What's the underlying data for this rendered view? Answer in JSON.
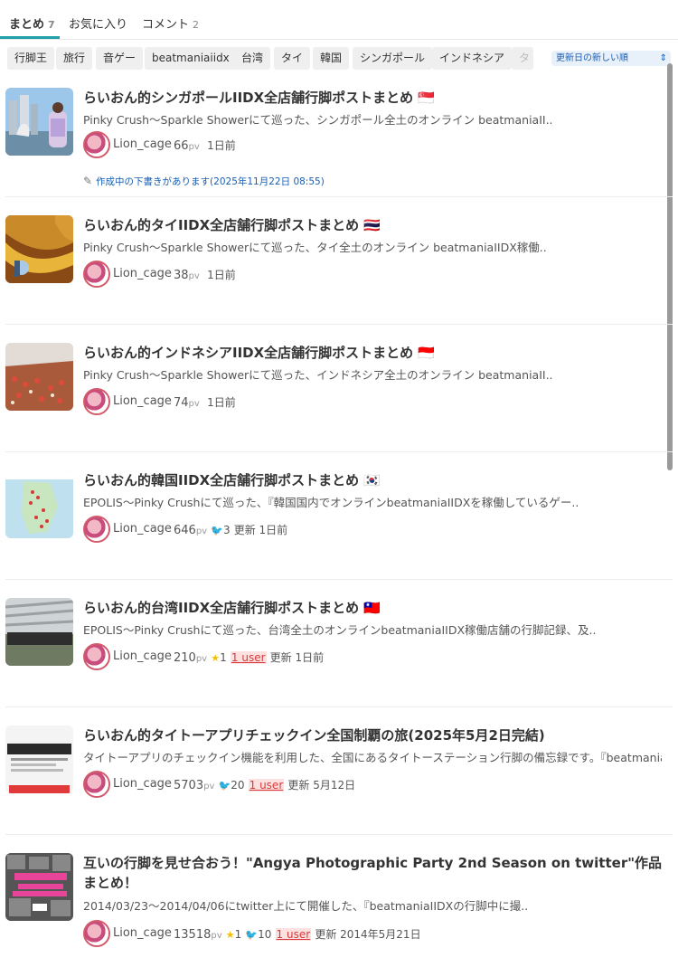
{
  "tabs": [
    {
      "label": "まとめ",
      "count": "7"
    },
    {
      "label": "お気に入り",
      "count": ""
    },
    {
      "label": "コメント",
      "count": "2"
    }
  ],
  "tags": [
    "行脚王",
    "旅行",
    "音ゲー",
    "beatmaniaiidx",
    "台湾",
    "タイ",
    "韓国",
    "シンガポール",
    "インドネシア",
    "タ"
  ],
  "sort": {
    "selected": "更新日の新しい順"
  },
  "draft_notice": "作成中の下書きがあります(2025年11月22日 08:55)",
  "items": [
    {
      "title": "らいおん的シンガポールIIDX全店舗行脚ポストまとめ",
      "flag": "🇸🇬",
      "desc": "Pinky Crush〜Sparkle Showerにて巡った、シンガポール全土のオンライン beatmaniaII..",
      "user": "Lion_cage",
      "pv": "66",
      "time": "1日前"
    },
    {
      "title": "らいおん的タイIIDX全店舗行脚ポストまとめ",
      "flag": "🇹🇭",
      "desc": "Pinky Crush〜Sparkle Showerにて巡った、タイ全土のオンライン beatmaniaIIDX稼働..",
      "user": "Lion_cage",
      "pv": "38",
      "time": "1日前"
    },
    {
      "title": "らいおん的インドネシアIIDX全店舗行脚ポストまとめ",
      "flag": "🇮🇩",
      "desc": "Pinky Crush〜Sparkle Showerにて巡った、インドネシア全土のオンライン beatmaniaII..",
      "user": "Lion_cage",
      "pv": "74",
      "time": "1日前"
    },
    {
      "title": "らいおん的韓国IIDX全店舗行脚ポストまとめ",
      "flag": "🇰🇷",
      "desc": "EPOLIS〜Pinky Crushにて巡った、『韓国国内でオンラインbeatmaniaIIDXを稼働しているゲー..",
      "user": "Lion_cage",
      "pv": "646",
      "tweets": "3",
      "time": "更新 1日前"
    },
    {
      "title": "らいおん的台湾IIDX全店舗行脚ポストまとめ",
      "flag": "🇹🇼",
      "desc": "EPOLIS〜Pinky Crushにて巡った、台湾全土のオンラインbeatmaniaIIDX稼働店舗の行脚記録、及..",
      "user": "Lion_cage",
      "pv": "210",
      "stars": "1",
      "users": "1 user",
      "time": "更新 1日前"
    },
    {
      "title": "らいおん的タイトーアプリチェックイン全国制覇の旅(2025年5月2日完結)",
      "flag": "",
      "desc": "タイトーアプリのチェックイン機能を利用した、全国にあるタイトーステーション行脚の備忘録です。『beatmanial..",
      "user": "Lion_cage",
      "pv": "5703",
      "tweets": "20",
      "users": "1 user",
      "time": "更新 5月12日"
    },
    {
      "title": "互いの行脚を見せ合おう！\"Angya Photographic Party 2nd Season on twitter\"作品まとめ！",
      "flag": "",
      "desc": "2014/03/23〜2014/04/06にtwitter上にて開催した、『beatmaniaIIDXの行脚中に撮..",
      "user": "Lion_cage",
      "pv": "13518",
      "stars": "1",
      "tweets": "10",
      "users": "1 user",
      "time": "更新 2014年5月21日"
    }
  ]
}
